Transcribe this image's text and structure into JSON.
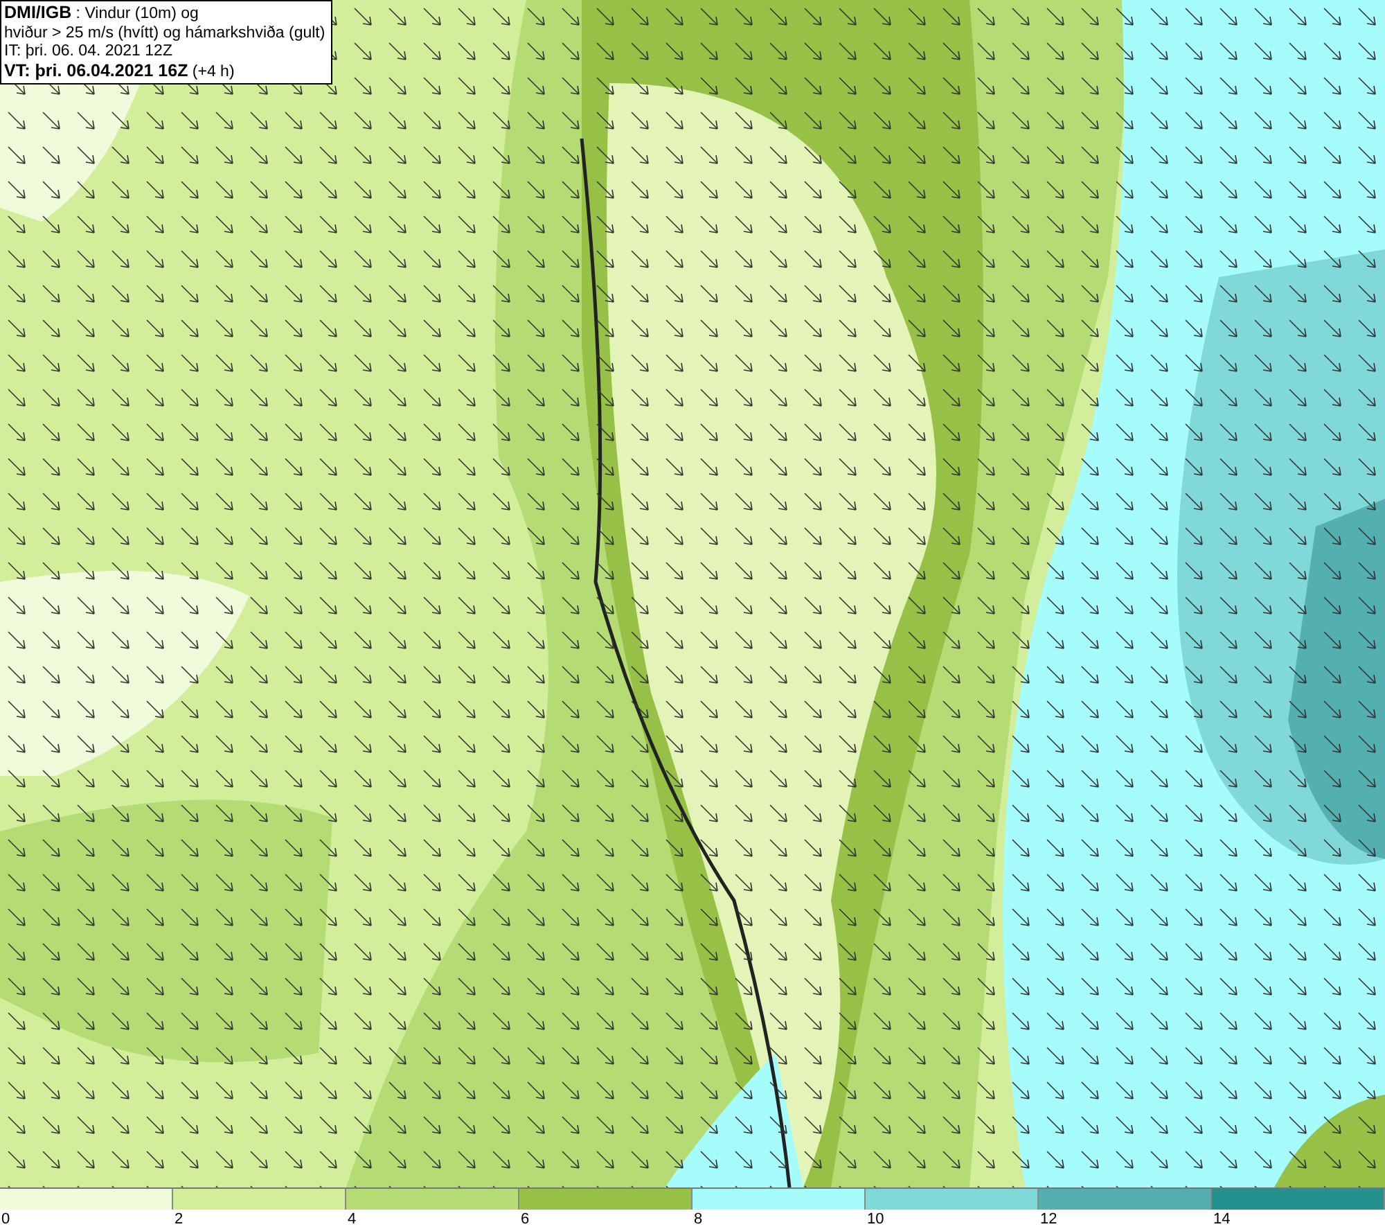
{
  "caption": {
    "lines": [
      "**DMI/IGB** : Vindur (10m) og",
      "hviður > 25 m/s (hvítt) og hámarkshviða (gult)",
      "IT: þri. 06. 04. 2021 12Z",
      "**VT: þri. 06.04.2021 16Z** (+4 h)"
    ]
  },
  "legend": {
    "bins": [
      {
        "color": "#f2fadc"
      },
      {
        "color": "#d3ee9b"
      },
      {
        "color": "#b5db74"
      },
      {
        "color": "#97c046"
      },
      {
        "color": "#a6fbfb"
      },
      {
        "color": "#80d8d8"
      },
      {
        "color": "#53afb0"
      },
      {
        "color": "#25918f"
      }
    ],
    "labels": [
      "0",
      "2",
      "4",
      "6",
      "8",
      "10",
      "12",
      "14"
    ]
  }
}
